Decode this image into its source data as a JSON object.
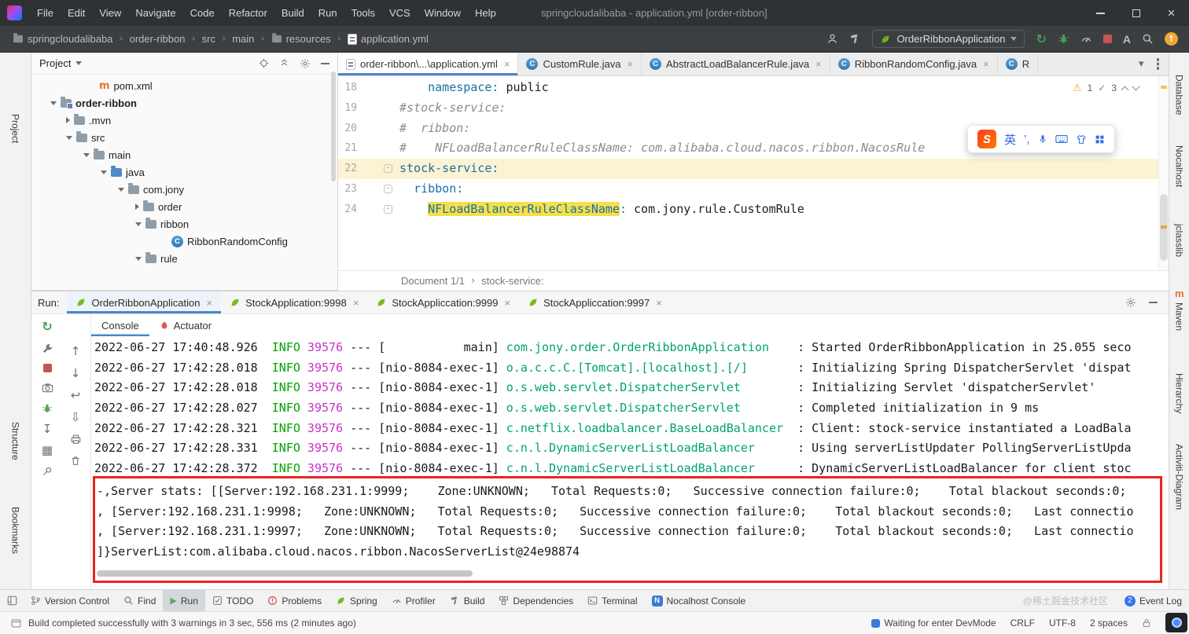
{
  "ui": {
    "close": "×",
    "sep": "›",
    "caret_overflow": "▾",
    "fold": "-"
  },
  "icons": {
    "class_glyph": "C",
    "maven_glyph": "m",
    "nocalhost_glyph": "N",
    "sogou_glyph": "S",
    "run_glyph": "▶",
    "rerun_glyph": "↻",
    "grid_glyph": "▦",
    "up_glyph": "↑",
    "down_glyph": "↓",
    "softwrap_glyph": "↩",
    "scrollend_glyph": "⇩",
    "import_glyph": "↧",
    "warn_glyph": "⚠",
    "check_glyph": "✓",
    "translate_glyph": "A",
    "update_glyph": "↑"
  },
  "titlebar": {
    "menus": [
      "File",
      "Edit",
      "View",
      "Navigate",
      "Code",
      "Refactor",
      "Build",
      "Run",
      "Tools",
      "VCS",
      "Window",
      "Help"
    ],
    "title": "springcloudalibaba - application.yml [order-ribbon]"
  },
  "toolbar": {
    "breadcrumbs": [
      "springcloudalibaba",
      "order-ribbon",
      "src",
      "main",
      "resources",
      "application.yml"
    ],
    "run_config": "OrderRibbonApplication"
  },
  "stripes": {
    "left": [
      "Project",
      "Structure",
      "Bookmarks"
    ],
    "right": [
      "Database",
      "Nocalhost",
      "jclasslib",
      "Maven",
      "Hierarchy",
      "Activiti-Diagram"
    ]
  },
  "project": {
    "header": "Project",
    "items": [
      {
        "label": "pom.xml"
      },
      {
        "label": "order-ribbon"
      },
      {
        "label": ".mvn"
      },
      {
        "label": "src"
      },
      {
        "label": "main"
      },
      {
        "label": "java"
      },
      {
        "label": "com.jony"
      },
      {
        "label": "order"
      },
      {
        "label": "ribbon"
      },
      {
        "label": "RibbonRandomConfig"
      },
      {
        "label": "rule"
      }
    ]
  },
  "editor": {
    "tabs": [
      {
        "label": "order-ribbon\\...\\application.yml"
      },
      {
        "label": "CustomRule.java"
      },
      {
        "label": "AbstractLoadBalancerRule.java"
      },
      {
        "label": "RibbonRandomConfig.java"
      },
      {
        "label": "R"
      }
    ],
    "inspections": {
      "warnings": "1",
      "weak_warnings": "3"
    },
    "lines": [
      {
        "num": "18",
        "indent": "    ",
        "key": "namespace:",
        "value": " public"
      },
      {
        "num": "19",
        "comment": "#stock-service:"
      },
      {
        "num": "20",
        "comment": "#  ribbon:"
      },
      {
        "num": "21",
        "comment": "#    NFLoadBalancerRuleClassName: com.alibaba.cloud.nacos.ribbon.NacosRule"
      },
      {
        "num": "22",
        "key": "stock-service:"
      },
      {
        "num": "23",
        "indent": "  ",
        "key": "ribbon:"
      },
      {
        "num": "24",
        "indent": "    ",
        "key": "NFLoadBalancerRuleClassName",
        "colon": ":",
        "value": " com.jony.rule.CustomRule"
      }
    ],
    "breadcrumb": {
      "doc": "Document 1/1",
      "node": "stock-service:"
    },
    "ime": {
      "lang": "英",
      "punct": "’,"
    }
  },
  "run": {
    "label": "Run:",
    "tabs": [
      "OrderRibbonApplication",
      "StockApplication:9998",
      "StockAppliccation:9999",
      "StockAppliccation:9997"
    ],
    "view_tabs": [
      "Console",
      "Actuator"
    ],
    "log_gap": "  ",
    "log_dashes": " --- ",
    "logs": [
      {
        "t": "2022-06-27 17:40:48.926",
        "lvl": "INFO",
        "pid": " 39576",
        "thr": "[           main]",
        "lg": " com.jony.order.OrderRibbonApplication",
        "sep": "    : ",
        "msg": "Started OrderRibbonApplication in 25.055 seco"
      },
      {
        "t": "2022-06-27 17:42:28.018",
        "lvl": "INFO",
        "pid": " 39576",
        "thr": "[nio-8084-exec-1]",
        "lg": " o.a.c.c.C.[Tomcat].[localhost].[/]",
        "sep": "       : ",
        "msg": "Initializing Spring DispatcherServlet 'dispat"
      },
      {
        "t": "2022-06-27 17:42:28.018",
        "lvl": "INFO",
        "pid": " 39576",
        "thr": "[nio-8084-exec-1]",
        "lg": " o.s.web.servlet.DispatcherServlet",
        "sep": "        : ",
        "msg": "Initializing Servlet 'dispatcherServlet'"
      },
      {
        "t": "2022-06-27 17:42:28.027",
        "lvl": "INFO",
        "pid": " 39576",
        "thr": "[nio-8084-exec-1]",
        "lg": " o.s.web.servlet.DispatcherServlet",
        "sep": "        : ",
        "msg": "Completed initialization in 9 ms"
      },
      {
        "t": "2022-06-27 17:42:28.321",
        "lvl": "INFO",
        "pid": " 39576",
        "thr": "[nio-8084-exec-1]",
        "lg": " c.netflix.loadbalancer.BaseLoadBalancer",
        "sep": "  : ",
        "msg": "Client: stock-service instantiated a LoadBala"
      },
      {
        "t": "2022-06-27 17:42:28.331",
        "lvl": "INFO",
        "pid": " 39576",
        "thr": "[nio-8084-exec-1]",
        "lg": " c.n.l.DynamicServerListLoadBalancer",
        "sep": "      : ",
        "msg": "Using serverListUpdater PollingServerListUpda"
      },
      {
        "t": "2022-06-27 17:42:28.372",
        "lvl": "INFO",
        "pid": " 39576",
        "thr": "[nio-8084-exec-1]",
        "lg": " c.n.l.DynamicServerListLoadBalancer",
        "sep": "      : ",
        "msg": "DynamicServerListLoadBalancer for client stoc"
      }
    ],
    "server_stats": [
      "-,Server stats: [[Server:192.168.231.1:9999;    Zone:UNKNOWN;   Total Requests:0;   Successive connection failure:0;    Total blackout seconds:0;",
      ", [Server:192.168.231.1:9998;   Zone:UNKNOWN;   Total Requests:0;   Successive connection failure:0;    Total blackout seconds:0;   Last connectio",
      ", [Server:192.168.231.1:9997;   Zone:UNKNOWN;   Total Requests:0;   Successive connection failure:0;    Total blackout seconds:0;   Last connectio",
      "]}ServerList:com.alibaba.cloud.nacos.ribbon.NacosServerList@24e98874"
    ]
  },
  "bottom": {
    "items": [
      "Version Control",
      "Find",
      "Run",
      "TODO",
      "Problems",
      "Spring",
      "Profiler",
      "Build",
      "Dependencies",
      "Terminal",
      "Nocalhost Console"
    ],
    "event_log": "Event Log",
    "event_count": "2",
    "watermark": "@稀土掘金技术社区"
  },
  "status": {
    "message": "Build completed successfully with 3 warnings in 3 sec, 556 ms (2 minutes ago)",
    "devmode": "Waiting for enter DevMode",
    "line_ending": "CRLF",
    "encoding": "UTF-8",
    "indent": "2 spaces"
  },
  "colors": {
    "accent": "#4A88C7",
    "highlight_box": "#E8261F",
    "log_info": "#00A400",
    "log_pid": "#C832C8",
    "yaml_key": "#1A6FA8",
    "token_highlight": "#F5E04A",
    "spring_green": "#77BC1F"
  }
}
